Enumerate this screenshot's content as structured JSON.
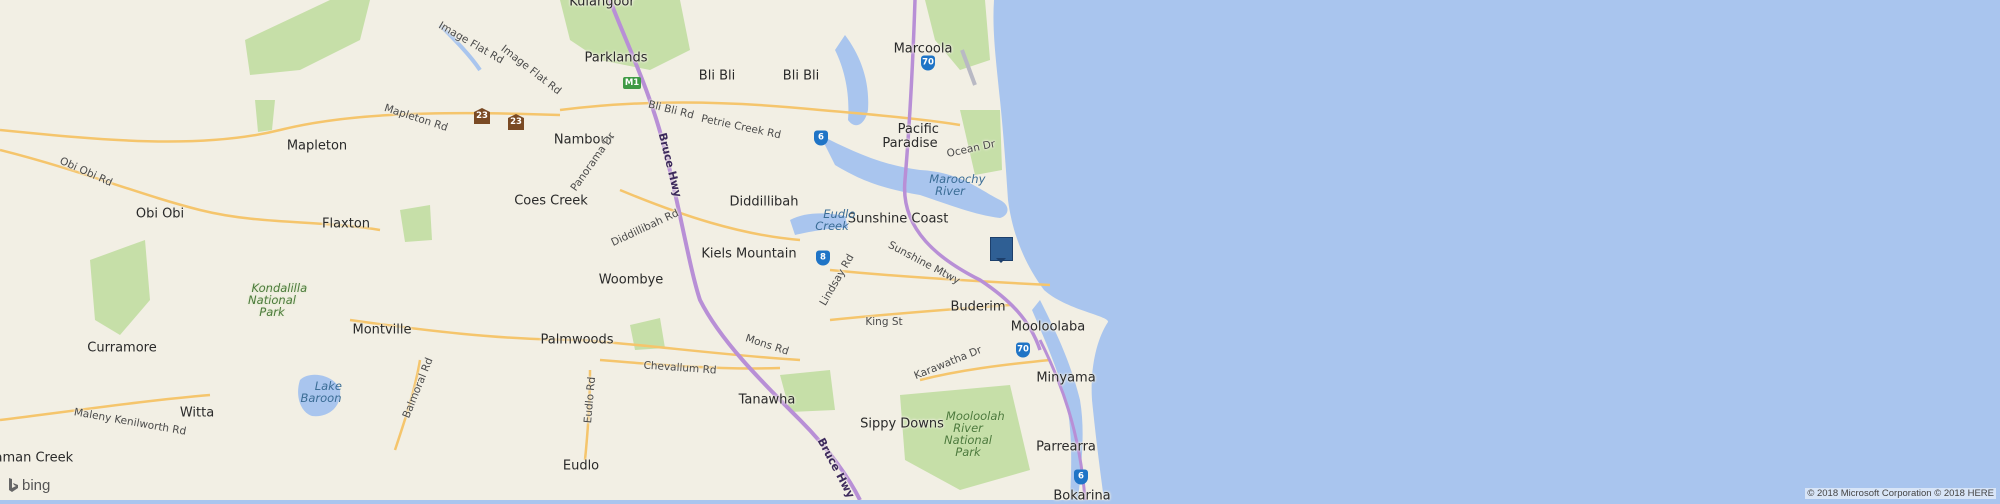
{
  "map": {
    "colors": {
      "ocean": "#a9c5ee",
      "land": "#f2efe4",
      "park": "#c6dfa8",
      "motorway": "#b88fd6",
      "road": "#f5c56c",
      "marker": "#2f5f94"
    },
    "places": [
      {
        "key": "kulangoor",
        "name": "Kulangoor"
      },
      {
        "key": "parklands",
        "name": "Parklands"
      },
      {
        "key": "bli-bli-1",
        "name": "Bli Bli"
      },
      {
        "key": "bli-bli-2",
        "name": "Bli Bli"
      },
      {
        "key": "marcoola",
        "name": "Marcoola"
      },
      {
        "key": "pacific-paradise",
        "name": "Pacific\nParadise"
      },
      {
        "key": "mapleton",
        "name": "Mapleton"
      },
      {
        "key": "nambour",
        "name": "Nambour"
      },
      {
        "key": "obi-obi",
        "name": "Obi Obi"
      },
      {
        "key": "coes-creek",
        "name": "Coes Creek"
      },
      {
        "key": "diddillibah",
        "name": "Diddillibah"
      },
      {
        "key": "flaxton",
        "name": "Flaxton"
      },
      {
        "key": "sunshine-coast",
        "name": "Sunshine Coast"
      },
      {
        "key": "kiels-mountain",
        "name": "Kiels Mountain"
      },
      {
        "key": "woombye",
        "name": "Woombye"
      },
      {
        "key": "buderim",
        "name": "Buderim"
      },
      {
        "key": "montville",
        "name": "Montville"
      },
      {
        "key": "mooloolaba",
        "name": "Mooloolaba"
      },
      {
        "key": "palmwoods",
        "name": "Palmwoods"
      },
      {
        "key": "curramore",
        "name": "Curramore"
      },
      {
        "key": "minyama",
        "name": "Minyama"
      },
      {
        "key": "tanawha",
        "name": "Tanawha"
      },
      {
        "key": "witta",
        "name": "Witta"
      },
      {
        "key": "sippy-downs",
        "name": "Sippy Downs"
      },
      {
        "key": "parrearra",
        "name": "Parrearra"
      },
      {
        "key": "maleny-creek",
        "name": "laman Creek"
      },
      {
        "key": "eudlo",
        "name": "Eudlo"
      },
      {
        "key": "bokarina",
        "name": "Bokarina"
      }
    ],
    "water_labels": [
      {
        "key": "maroochy-river",
        "name": "Maroochy\nRiver"
      },
      {
        "key": "eudlo-creek",
        "name": "Eudlo\nCreek"
      },
      {
        "key": "lake-baroon",
        "name": "Lake\nBaroon"
      }
    ],
    "park_labels": [
      {
        "key": "kondalilla",
        "name": "Kondalilla\nNational\nPark"
      },
      {
        "key": "mooloolah-river",
        "name": "Mooloolah\nRiver\nNational\nPark"
      }
    ],
    "road_labels": [
      {
        "key": "image-flat-rd-1",
        "name": "Image Flat Rd"
      },
      {
        "key": "image-flat-rd-2",
        "name": "Image Flat Rd"
      },
      {
        "key": "mapleton-rd",
        "name": "Mapleton Rd"
      },
      {
        "key": "bli-bli-rd",
        "name": "Bli Bli Rd"
      },
      {
        "key": "petrie-creek-rd",
        "name": "Petrie Creek Rd"
      },
      {
        "key": "obi-obi-rd",
        "name": "Obi Obi Rd"
      },
      {
        "key": "panorama-dr",
        "name": "Panorama Dr"
      },
      {
        "key": "diddillibah-rd",
        "name": "Diddillibah Rd"
      },
      {
        "key": "ocean-dr",
        "name": "Ocean Dr"
      },
      {
        "key": "sunshine-mtwy",
        "name": "Sunshine Mtwy"
      },
      {
        "key": "lindsay-rd",
        "name": "Lindsay Rd"
      },
      {
        "key": "king-st",
        "name": "King St"
      },
      {
        "key": "mons-rd",
        "name": "Mons Rd"
      },
      {
        "key": "chevallum-rd",
        "name": "Chevallum Rd"
      },
      {
        "key": "karawatha-dr",
        "name": "Karawatha Dr"
      },
      {
        "key": "balmoral-rd",
        "name": "Balmoral Rd"
      },
      {
        "key": "eudlo-rd",
        "name": "Eudlo Rd"
      },
      {
        "key": "maleny-kenilworth-rd",
        "name": "Maleny Kenilworth Rd"
      }
    ],
    "highway_labels": [
      {
        "key": "bruce-hwy-1",
        "name": "Bruce Hwy"
      },
      {
        "key": "bruce-hwy-2",
        "name": "Bruce Hwy"
      }
    ],
    "shields": [
      {
        "key": "m1",
        "label": "M1",
        "style": "green"
      },
      {
        "key": "r23a",
        "label": "23",
        "style": "brown"
      },
      {
        "key": "r23b",
        "label": "23",
        "style": "brown"
      },
      {
        "key": "r70a",
        "label": "70",
        "style": "blue"
      },
      {
        "key": "r6a",
        "label": "6",
        "style": "blue"
      },
      {
        "key": "r8",
        "label": "8",
        "style": "blue"
      },
      {
        "key": "r70b",
        "label": "70",
        "style": "blue"
      },
      {
        "key": "r6b",
        "label": "6",
        "style": "blue"
      }
    ],
    "attribution": {
      "logo": "bing",
      "copyright": "© 2018 Microsoft Corporation © 2018 HERE"
    }
  }
}
